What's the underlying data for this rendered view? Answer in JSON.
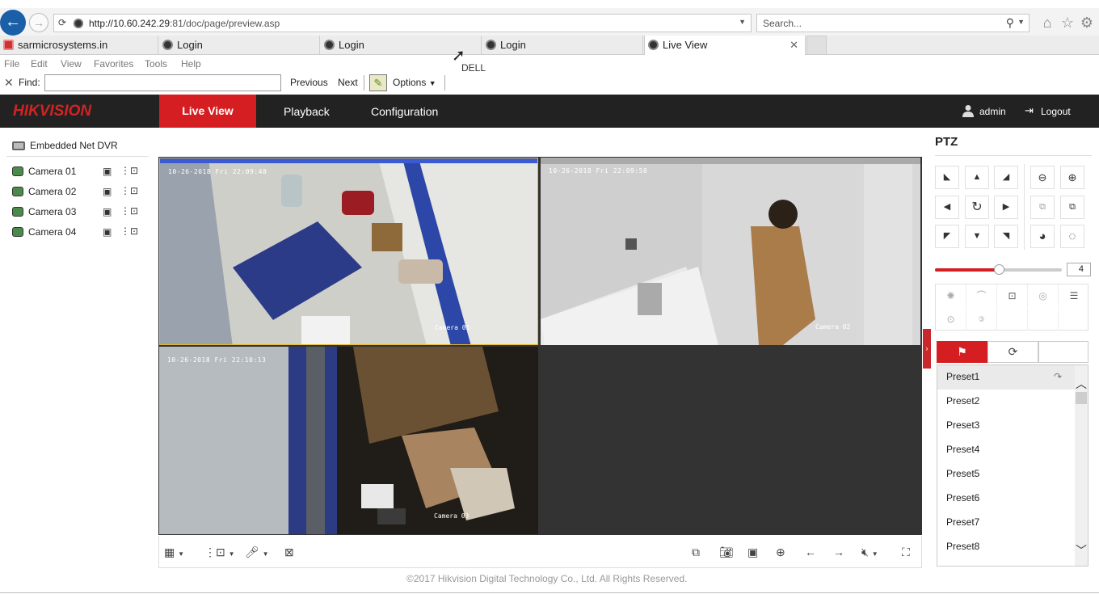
{
  "browser": {
    "url_host": "http://10.60.242.29",
    "url_rest": ":81/doc/page/preview.asp",
    "search_placeholder": "Search...",
    "tabs": [
      {
        "label": "sarmicrosystems.in"
      },
      {
        "label": "Login"
      },
      {
        "label": "Login"
      },
      {
        "label": "Login"
      },
      {
        "label": "Live View"
      }
    ],
    "menu": [
      "File",
      "Edit",
      "View",
      "Favorites",
      "Tools",
      "Help"
    ],
    "tooltip": "DELL",
    "find": {
      "label": "Find:",
      "value": "",
      "previous": "Previous",
      "next": "Next",
      "options": "Options"
    }
  },
  "header": {
    "logo": "HIKVISION",
    "nav": {
      "live_view": "Live View",
      "playback": "Playback",
      "configuration": "Configuration"
    },
    "user": "admin",
    "logout": "Logout"
  },
  "device_tree": {
    "root": "Embedded Net DVR",
    "cameras": [
      "Camera 01",
      "Camera 02",
      "Camera 03",
      "Camera 04"
    ]
  },
  "video": {
    "tiles": [
      {
        "timestamp": "10-26-2018 Fri 22:09:48",
        "cam": "Camera 01"
      },
      {
        "timestamp": "10-26-2018 Fri 22:09:58",
        "cam": "Camera 02"
      },
      {
        "timestamp": "10-26-2018 Fri 22:10:13",
        "cam": "Camera 03"
      }
    ]
  },
  "ptz": {
    "title": "PTZ",
    "speed": "4",
    "presets": [
      "Preset1",
      "Preset2",
      "Preset3",
      "Preset4",
      "Preset5",
      "Preset6",
      "Preset7",
      "Preset8"
    ]
  },
  "footer": {
    "copyright": "©2017 Hikvision Digital Technology Co., Ltd. All Rights Reserved."
  },
  "colors": {
    "accent": "#d41e21",
    "header_bg": "#222222",
    "tile_selected": "#e7b923"
  }
}
